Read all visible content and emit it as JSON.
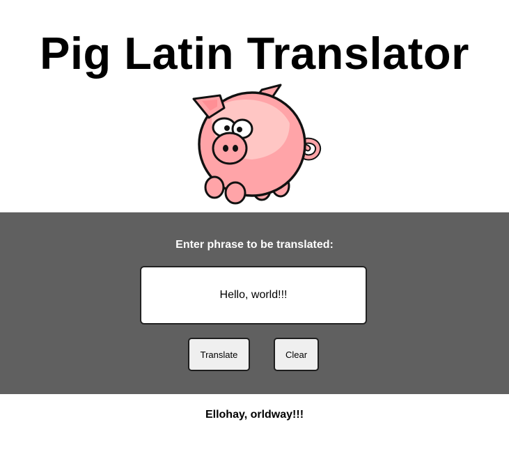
{
  "header": {
    "title": "Pig Latin Translator",
    "logo_icon": "pig-icon"
  },
  "form": {
    "prompt": "Enter phrase to be translated:",
    "input_value": "Hello, world!!!",
    "translate_label": "Translate",
    "clear_label": "Clear"
  },
  "output": {
    "result": "Ellohay, orldway!!!"
  },
  "colors": {
    "panel_background": "#606060",
    "pig_body": "#ffa4a8",
    "pig_highlight": "#ffc6c4",
    "button_background": "#efefef"
  }
}
